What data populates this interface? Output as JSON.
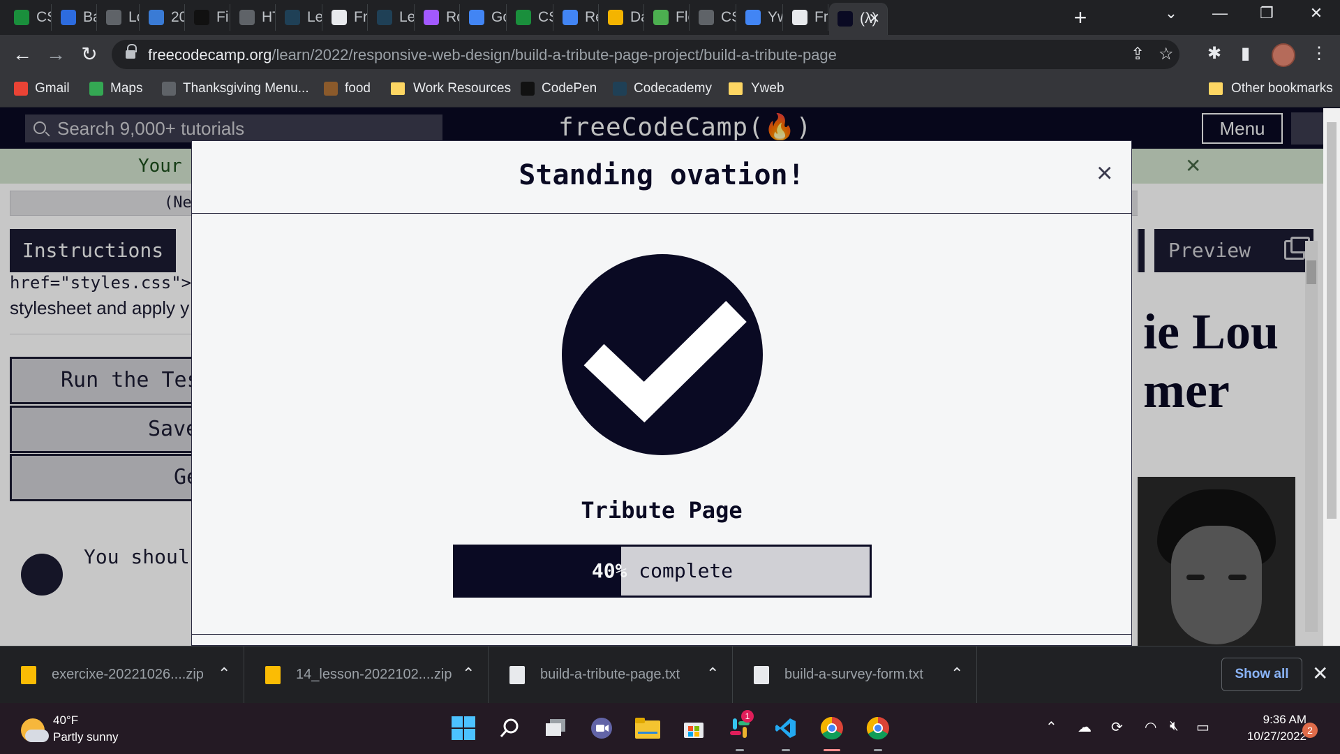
{
  "browser": {
    "tabs": [
      {
        "label": "CS",
        "icon": "w-icon",
        "color": "#1a8f3c"
      },
      {
        "label": "Ba",
        "icon": "w3-icon",
        "color": "#2d6cdf"
      },
      {
        "label": "Lo",
        "icon": "doc-icon",
        "color": "#5f6368"
      },
      {
        "label": "20",
        "icon": "p-icon",
        "color": "#3a7bd5"
      },
      {
        "label": "Fir",
        "icon": "codepen-icon",
        "color": "#111"
      },
      {
        "label": "HT",
        "icon": "globe-icon",
        "color": "#5f6368"
      },
      {
        "label": "Le",
        "icon": "codecademy-icon",
        "color": "#1f4056"
      },
      {
        "label": "Fr",
        "icon": "fcc-page-icon",
        "color": "#e8eaed"
      },
      {
        "label": "Le",
        "icon": "codecademy-icon",
        "color": "#1f4056"
      },
      {
        "label": "Ro",
        "icon": "figma-icon",
        "color": "#a259ff"
      },
      {
        "label": "Go",
        "icon": "calendar-icon",
        "color": "#4285f4"
      },
      {
        "label": "CS",
        "icon": "w-icon",
        "color": "#1a8f3c"
      },
      {
        "label": "Re",
        "icon": "docs-icon",
        "color": "#4285f4"
      },
      {
        "label": "Da",
        "icon": "face-icon",
        "color": "#f4b400"
      },
      {
        "label": "Fle",
        "icon": "frog-icon",
        "color": "#4caf50"
      },
      {
        "label": "CS",
        "icon": "globe-icon",
        "color": "#5f6368"
      },
      {
        "label": "Yw",
        "icon": "docs-icon",
        "color": "#4285f4"
      },
      {
        "label": "Fre",
        "icon": "fcc-page-icon",
        "color": "#e8eaed"
      },
      {
        "label": "(λ)",
        "icon": "fcc-icon",
        "color": "#0a0a23"
      }
    ],
    "url_host": "freecodecamp.org",
    "url_path": "/learn/2022/responsive-web-design/build-a-tribute-page-project/build-a-tribute-page",
    "bookmarks": [
      {
        "label": "Gmail",
        "icon": "gmail-icon",
        "color": "#ea4335"
      },
      {
        "label": "Maps",
        "icon": "maps-icon",
        "color": "#34a853"
      },
      {
        "label": "Thanksgiving Menu...",
        "icon": "recipe-icon",
        "color": "#5f6368"
      },
      {
        "label": "food",
        "icon": "fork-icon",
        "color": "#8b5a2b"
      },
      {
        "label": "Work Resources",
        "icon": "folder-icon",
        "color": "#fdd663"
      },
      {
        "label": "CodePen",
        "icon": "codepen-icon",
        "color": "#111"
      },
      {
        "label": "Codecademy",
        "icon": "codecademy-icon",
        "color": "#1f4056"
      },
      {
        "label": "Yweb",
        "icon": "folder-icon",
        "color": "#fdd663"
      }
    ],
    "other_bookmarks": "Other bookmarks"
  },
  "fcc": {
    "search_placeholder": "Search 9,000+ tutorials",
    "logo": "freeCodeCamp(🔥)",
    "menu_label": "Menu",
    "banner_text": "Your",
    "new_line_text": "(Ne",
    "instructions_tab": "Instructions",
    "code_snippet": "href=\"styles.css\">",
    "text_snippet": "stylesheet and apply y",
    "run_tests_label": "Run the Tes",
    "save_label": "Save",
    "get_help_label": "Ge",
    "hint_text": "You shoul",
    "preview_tab": "Preview",
    "tribute_heading_line1": "ie Lou",
    "tribute_heading_line2": "mer"
  },
  "modal": {
    "title": "Standing ovation!",
    "project_name": "Tribute Page",
    "progress_percent": 40,
    "progress_number": "40%",
    "progress_suffix": " complete"
  },
  "downloads": {
    "items": [
      {
        "name": "exercixe-20221026....zip",
        "type": "zip"
      },
      {
        "name": "14_lesson-2022102....zip",
        "type": "zip"
      },
      {
        "name": "build-a-tribute-page.txt",
        "type": "txt"
      },
      {
        "name": "build-a-survey-form.txt",
        "type": "txt"
      }
    ],
    "show_all": "Show all"
  },
  "taskbar": {
    "temperature": "40°F",
    "weather": "Partly sunny",
    "time": "9:36 AM",
    "date": "10/27/2022",
    "notification_count": "2",
    "slack_badge": "1"
  }
}
